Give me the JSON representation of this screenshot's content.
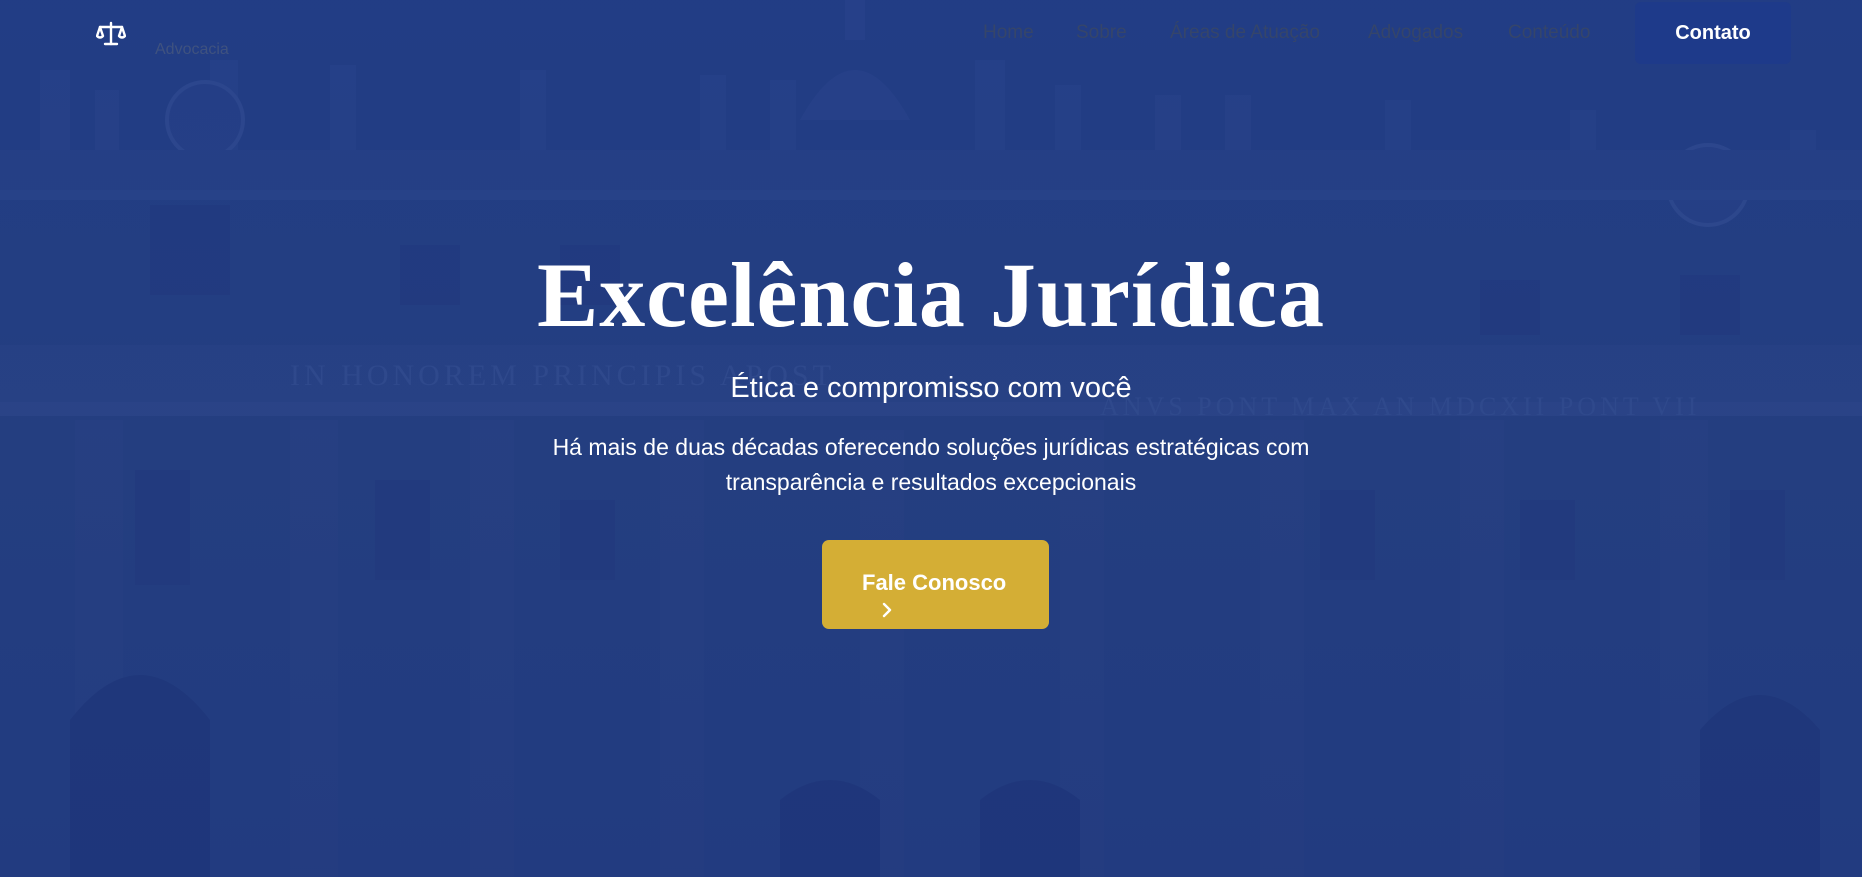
{
  "brand": {
    "logo_icon": "scales-of-justice-icon",
    "name": "Advocacia"
  },
  "nav": {
    "items": [
      {
        "label": "Home"
      },
      {
        "label": "Sobre"
      },
      {
        "label": "Áreas de Atuação"
      },
      {
        "label": "Advogados"
      },
      {
        "label": "Conteúdo"
      }
    ],
    "contact_label": "Contato"
  },
  "hero": {
    "title": "Excelência Jurídica",
    "subtitle": "Ética e compromisso com você",
    "description": "Há mais de duas décadas oferecendo soluções jurídicas estratégicas com transparência e resultados excepcionais",
    "cta_label": "Fale Conosco",
    "cta_icon": "chevron-right-icon",
    "background": "building-facade-photo"
  },
  "colors": {
    "overlay": "#1e3a8a",
    "accent_gold": "#d4ae35",
    "nav_text": "#35456a",
    "text_white": "#ffffff"
  }
}
